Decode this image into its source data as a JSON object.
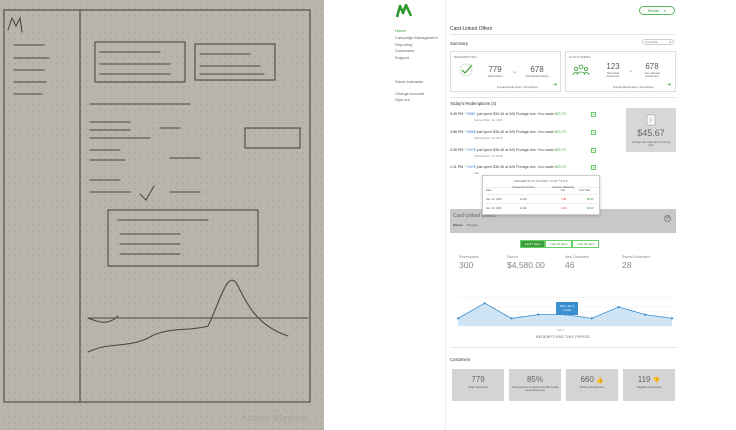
{
  "sketch": {
    "brand": "Action Method"
  },
  "nav": {
    "items": [
      "Home",
      "Campaign Management",
      "Reporting",
      "Customers",
      "Support"
    ],
    "account": [
      "Stock Indicadas",
      "Change Account",
      "Sign out"
    ]
  },
  "header": {
    "button_label": "Rentarr",
    "title": "Card-Linked Offers"
  },
  "summary": {
    "heading": "Summary",
    "range": "3 months",
    "redemption": {
      "label": "REDEMPTION",
      "value_a": "779",
      "caption_a": "Total Claims",
      "vs": "vs",
      "value_b": "678",
      "caption_b": "Total Redemptions",
      "link": "Popular Redemption Times/Days"
    },
    "customers": {
      "label": "CUSTOMERS",
      "value_a": "123",
      "caption_a": "New Total Customers",
      "vs": "vs",
      "value_b": "678",
      "caption_b": "Your Repeat Customers",
      "link": "Popular Redemption Times/Days"
    }
  },
  "redemptions": {
    "heading": "Today's Redemptions (4)",
    "rows": [
      {
        "time": "5:45 PM",
        "id": "**9567",
        "text": " just spent $36.46 at 526 Portage Ave. You made ",
        "amount": "$20.70",
        "sub": "Claimed Dec. 13, 2016"
      },
      {
        "time": "3:56 PM",
        "id": "**5698",
        "text": " just spent $36.46 at 526 Portage Ave. You made ",
        "amount": "$20.70",
        "sub": "Claimed Dec. 13, 2016"
      },
      {
        "time": "2:36 PM",
        "id": "**4378",
        "text": " just spent $36.46 at 526 Portage Ave. You made ",
        "amount": "$20.70",
        "sub": "Claimed Dec. 13, 2016"
      },
      {
        "time": "1:11 PM",
        "id": "**4378",
        "text": " just spent $36.46 at 526 Portage Ave. You made ",
        "amount": "$20.70",
        "sub": "Clai"
      }
    ],
    "stat": {
      "value": "$45.67",
      "caption": "Average Net Value (this Incoming Ask)"
    }
  },
  "tooltip": {
    "title": "REDEMPTION HISTORY FOR **4378",
    "headers": [
      "Date",
      "Transaction Amount",
      "Groupon Marketing Fee",
      "Your Take"
    ],
    "rows": [
      [
        "Jan. 04, 2016",
        "12.99",
        "1.99",
        "$8.99"
      ],
      [
        "Jan. 04, 2016",
        "12.99",
        "1.99",
        "$9.99"
      ]
    ]
  },
  "graph": {
    "heading": "Card-Linked Offers",
    "subtitle": "Market",
    "subtitle_value": "The app",
    "tabs": [
      "Last 7 days",
      "Last 30 days",
      "Last 90 days"
    ],
    "metrics": [
      {
        "label": "Redemptions",
        "value": "300"
      },
      {
        "label": "Earned",
        "value": "$4,580.00"
      },
      {
        "label": "New Customers",
        "value": "46"
      },
      {
        "label": "Repeat Customers",
        "value": "28"
      }
    ],
    "tip_title": "Mon, Jan 4",
    "tip_value": "2 sales",
    "x_caption": "JAN 4",
    "chart_title": "REDEMPTIONS THIS PERIOD"
  },
  "chart_data": {
    "type": "area",
    "x": [
      1,
      2,
      3,
      4,
      5,
      6,
      7,
      8,
      9
    ],
    "values": [
      2,
      6,
      2,
      3,
      3,
      2,
      5,
      3,
      2
    ],
    "ylim": [
      0,
      10
    ],
    "title": "REDEMPTIONS THIS PERIOD",
    "color": "#cfe4f4",
    "line_color": "#3a8fd0"
  },
  "customers_section": {
    "heading": "Customers",
    "boxes": [
      {
        "value": "779",
        "label": "Total responses"
      },
      {
        "value": "85%",
        "label": "Total percent of customers that would recommend you"
      },
      {
        "value": "660",
        "label": "Positive Responses"
      },
      {
        "value": "119",
        "label": "Negative comments"
      }
    ]
  }
}
